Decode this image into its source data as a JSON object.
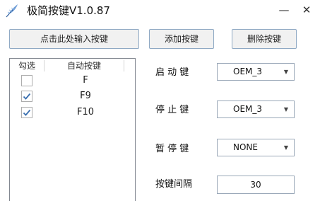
{
  "window": {
    "title": "极简按键V1.0.87",
    "minimize_glyph": "—",
    "close_glyph": "✕",
    "icon": "feather-quill-icon"
  },
  "toolbar": {
    "input_hint_button": "点击此处输入按键",
    "add_button": "添加按键",
    "delete_button": "删除按键"
  },
  "key_list": {
    "columns": [
      "勾选",
      "自动按键"
    ],
    "rows": [
      {
        "checked": false,
        "key": "F"
      },
      {
        "checked": true,
        "key": "F9"
      },
      {
        "checked": true,
        "key": "F10"
      }
    ]
  },
  "settings": {
    "start_key": {
      "label": "启 动 键",
      "value": "OEM_3"
    },
    "stop_key": {
      "label": "停 止 键",
      "value": "OEM_3"
    },
    "pause_key": {
      "label": "暂 停 键",
      "value": "NONE"
    },
    "interval": {
      "label": "按键间隔",
      "value": "30"
    }
  },
  "colors": {
    "checkmark": "#3a6fb0",
    "button_border": "#8fa9c4"
  }
}
